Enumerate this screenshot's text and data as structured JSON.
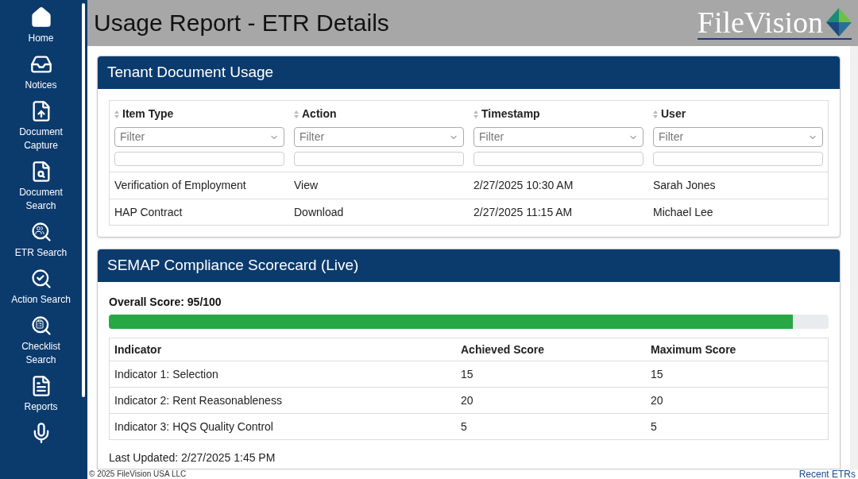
{
  "sidebar": {
    "items": [
      {
        "label": "Home"
      },
      {
        "label": "Notices"
      },
      {
        "label": "Document Capture"
      },
      {
        "label": "Document Search"
      },
      {
        "label": "ETR Search"
      },
      {
        "label": "Action Search"
      },
      {
        "label": "Checklist Search"
      },
      {
        "label": "Reports"
      }
    ]
  },
  "header": {
    "title": "Usage Report - ETR Details",
    "logo": "FileVision"
  },
  "usage": {
    "title": "Tenant Document Usage",
    "columns": [
      {
        "label": "Item Type",
        "placeholder": "Filter"
      },
      {
        "label": "Action",
        "placeholder": "Filter"
      },
      {
        "label": "Timestamp",
        "placeholder": "Filter"
      },
      {
        "label": "User",
        "placeholder": "Filter"
      }
    ],
    "rows": [
      [
        "Verification of Employment",
        "View",
        "2/27/2025 10:30 AM",
        "Sarah Jones"
      ],
      [
        "HAP Contract",
        "Download",
        "2/27/2025 11:15 AM",
        "Michael Lee"
      ]
    ]
  },
  "scorecard": {
    "title": "SEMAP Compliance Scorecard (Live)",
    "overall": "Overall Score: 95/100",
    "level": 0.95,
    "columns": [
      "Indicator",
      "Achieved Score",
      "Maximum Score"
    ],
    "rows": [
      [
        "Indicator 1: Selection",
        "15",
        "15"
      ],
      [
        "Indicator 2: Rent Reasonableness",
        "20",
        "20"
      ],
      [
        "Indicator 3: HQS Quality Control",
        "5",
        "5"
      ]
    ],
    "updated": "Last Updated: 2/27/2025 1:45 PM"
  },
  "footer": {
    "copyright": "© 2025 FileVision USA LLC",
    "link": "Recent ETRs"
  }
}
